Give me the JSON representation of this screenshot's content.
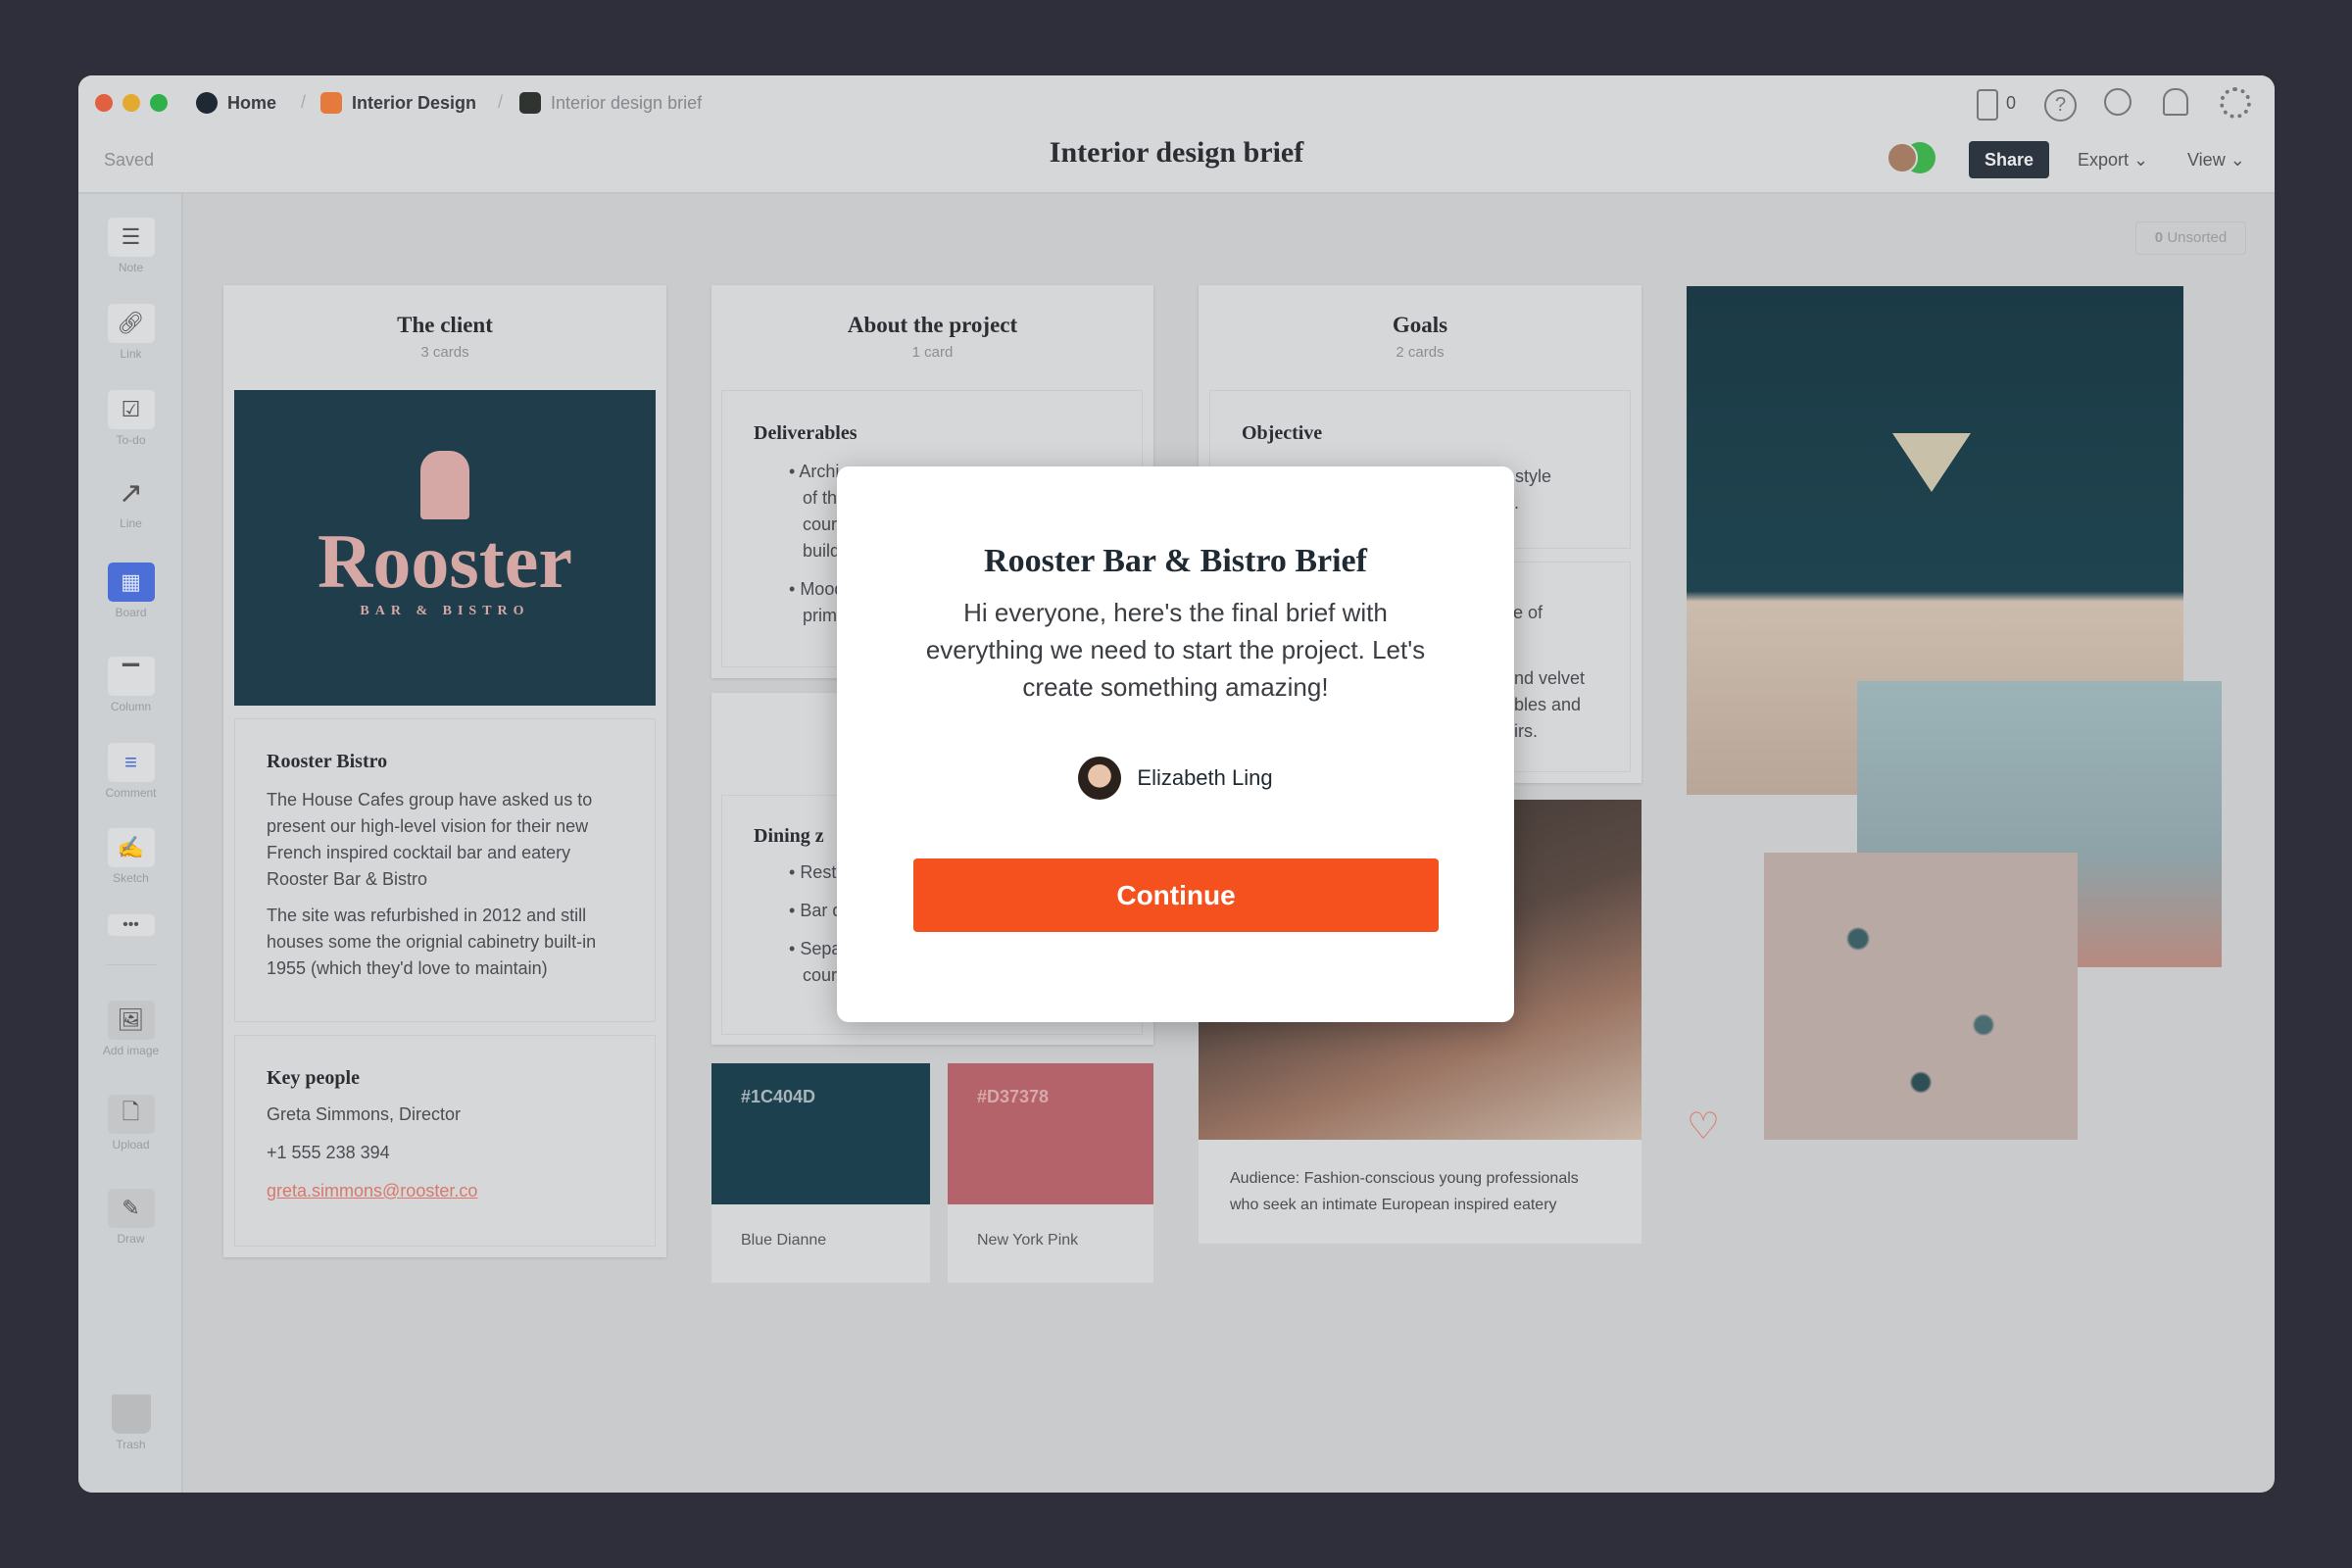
{
  "breadcrumb": {
    "home": "Home",
    "project": "Interior Design",
    "board": "Interior design brief"
  },
  "header": {
    "status": "Saved",
    "title": "Interior design brief",
    "device_count": "0",
    "share": "Share",
    "export": "Export",
    "view": "View",
    "unsorted_count": "0",
    "unsorted_label": "Unsorted"
  },
  "sidebar": {
    "items": [
      {
        "label": "Note",
        "icon": "note-icon"
      },
      {
        "label": "Link",
        "icon": "link-icon"
      },
      {
        "label": "To-do",
        "icon": "todo-icon"
      },
      {
        "label": "Line",
        "icon": "line-icon"
      },
      {
        "label": "Board",
        "icon": "board-icon"
      },
      {
        "label": "Column",
        "icon": "column-icon"
      },
      {
        "label": "Comment",
        "icon": "comment-icon"
      },
      {
        "label": "Sketch",
        "icon": "sketch-icon"
      },
      {
        "label": "Add image",
        "icon": "image-icon"
      },
      {
        "label": "Upload",
        "icon": "upload-icon"
      },
      {
        "label": "Draw",
        "icon": "pencil-icon"
      },
      {
        "label": "Trash",
        "icon": "trash-icon"
      }
    ]
  },
  "client": {
    "title": "The client",
    "count": "3 cards",
    "logo_text": "Rooster",
    "logo_sub": "BAR & BISTRO",
    "bistro": {
      "title": "Rooster Bistro",
      "p1": "The House Cafes group have asked us to present our high-level vision for their new French inspired cocktail bar and eatery Rooster Bar & Bistro",
      "p2": "The site was refurbished in 2012 and still houses some the orignial cabinetry built-in 1955 (which they'd love to maintain)"
    },
    "people": {
      "title": "Key people",
      "name": "Greta Simmons, Director",
      "phone": "+1 555 238 394",
      "email": "greta.simmons@rooster.co"
    }
  },
  "project": {
    "title": "About the project",
    "count": "1 card",
    "deliverables_title": "Deliverables",
    "deliverables_fragments": [
      "Archi",
      "of the",
      "court",
      "buildi",
      "Mood",
      "prima"
    ],
    "dining_title": "Dining z",
    "dining_fragments": [
      "Resta",
      "Bar di",
      "Separ",
      "court"
    ]
  },
  "swatches": [
    {
      "hex": "#1C404D",
      "name": "Blue Dianne",
      "color": "#1c404d"
    },
    {
      "hex": "#D37378",
      "name": "New York Pink",
      "color": "#b5636a"
    }
  ],
  "goals": {
    "title": "Goals",
    "count": "2 cards",
    "objective_title": "Objective",
    "objective_fragments": [
      "r style",
      "d."
    ],
    "second_fragments": [
      "se of",
      "and velvet",
      "ables and",
      "airs."
    ],
    "audience": "Audience: Fashion-conscious young professionals who seek an intimate European inspired eatery"
  },
  "modal": {
    "title": "Rooster Bar & Bistro Brief",
    "body": "Hi everyone, here's the final brief with everything we need to start the project. Let's create something amazing!",
    "author": "Elizabeth Ling",
    "button": "Continue",
    "button_color": "#f4511e"
  }
}
